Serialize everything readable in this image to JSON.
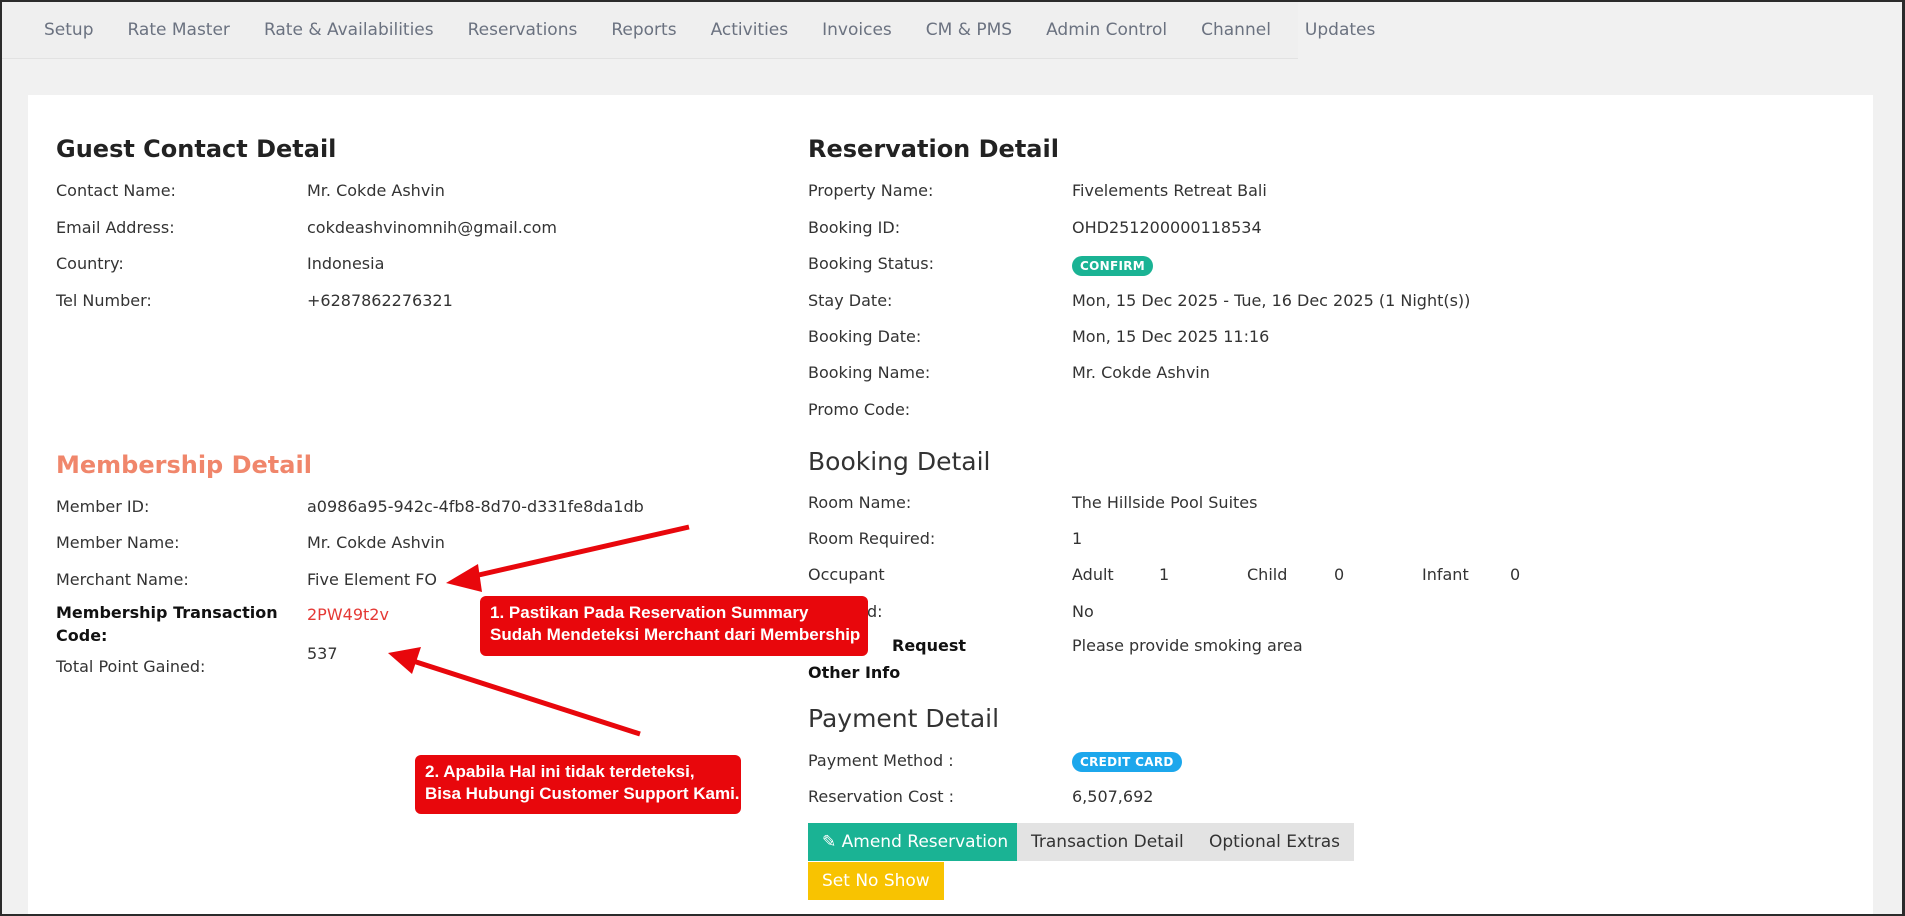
{
  "nav": [
    "Setup",
    "Rate Master",
    "Rate & Availabilities",
    "Reservations",
    "Reports",
    "Activities",
    "Invoices",
    "CM & PMS",
    "Admin Control",
    "Channel",
    "Updates"
  ],
  "guest": {
    "title": "Guest Contact Detail",
    "contact_name_label": "Contact Name:",
    "contact_name": "Mr. Cokde Ashvin",
    "email_label": "Email Address:",
    "email": "cokdeashvinomnih@gmail.com",
    "country_label": "Country:",
    "country": "Indonesia",
    "tel_label": "Tel Number:",
    "tel": "+6287862276321"
  },
  "membership": {
    "title": "Membership Detail",
    "member_id_label": "Member ID:",
    "member_id": "a0986a95-942c-4fb8-8d70-d331fe8da1db",
    "member_name_label": "Member Name:",
    "member_name": "Mr. Cokde Ashvin",
    "merchant_name_label": "Merchant Name:",
    "merchant_name": "Five Element FO",
    "transaction_code_label_1": "Membership Transaction",
    "transaction_code_label_2": "Code:",
    "transaction_code": "2PW49t2v",
    "points_label": "Total Point Gained:",
    "points": "537"
  },
  "reservation": {
    "title": "Reservation Detail",
    "property_label": "Property Name:",
    "property": "Fivelements Retreat Bali",
    "booking_id_label": "Booking ID:",
    "booking_id": "OHD251200000118534",
    "status_label": "Booking Status:",
    "status": "CONFIRM",
    "stay_label": "Stay Date:",
    "stay": "Mon, 15 Dec 2025 - Tue, 16 Dec 2025 (1 Night(s))",
    "booking_date_label": "Booking Date:",
    "booking_date": "Mon, 15 Dec 2025 11:16",
    "booking_name_label": "Booking Name:",
    "booking_name": "Mr. Cokde Ashvin",
    "promo_label": "Promo Code:",
    "promo": ""
  },
  "booking": {
    "title": "Booking Detail",
    "room_name_label": "Room Name:",
    "room_name": "The Hillside Pool Suites",
    "room_required_label": "Room Required:",
    "room_required": "1",
    "occupant_label": "Occupant",
    "adult_label": "Adult",
    "adult": "1",
    "child_label": "Child",
    "child": "0",
    "infant_label": "Infant",
    "infant": "0",
    "refund_label_visible": "d:",
    "refund_value": "No",
    "request_label_visible": "Request",
    "request_value": "Please provide smoking area",
    "other_info_label": "Other Info"
  },
  "payment": {
    "title": "Payment Detail",
    "method_label": "Payment Method :",
    "method": "CREDIT CARD",
    "cost_label": "Reservation Cost :",
    "cost": "6,507,692"
  },
  "buttons": {
    "amend": "Amend Reservation",
    "transaction": "Transaction Detail",
    "extras": "Optional Extras",
    "no_show": "Set No Show"
  },
  "callouts": {
    "one_line1": "1. Pastikan Pada Reservation Summary",
    "one_line2": "Sudah Mendeteksi Merchant dari Membership",
    "two_line1": "2. Apabila Hal ini tidak terdeteksi,",
    "two_line2": "Bisa Hubungi Customer Support Kami."
  },
  "colors": {
    "confirm_badge": "#1ab394",
    "credit_badge": "#1ca7ec",
    "membership_title": "#f0866b",
    "annotation_red": "#e8070c"
  }
}
